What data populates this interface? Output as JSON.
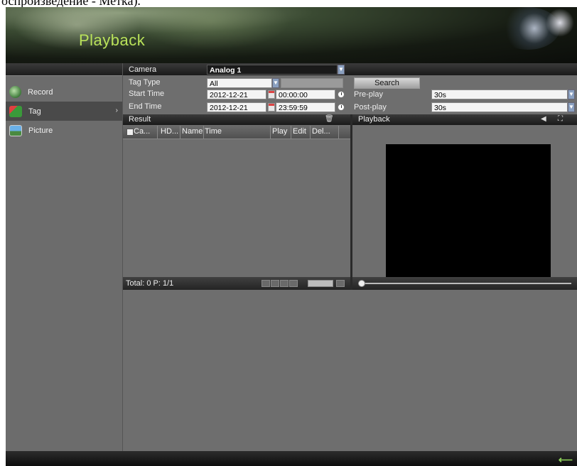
{
  "caption": {
    "text": "оспроизведение - Метка)."
  },
  "header": {
    "title": "Playback"
  },
  "sidebar": {
    "items": [
      {
        "label": "Record",
        "icon": "record-icon"
      },
      {
        "label": "Tag",
        "icon": "tag-icon",
        "arrow": "›",
        "active": true
      },
      {
        "label": "Picture",
        "icon": "picture-icon"
      }
    ]
  },
  "form": {
    "camera_label": "Camera",
    "camera_value": "Analog 1",
    "tag_type_label": "Tag Type",
    "tag_type_value": "All",
    "tag_type_text": "",
    "start_time_label": "Start Time",
    "start_date": "2012-12-21",
    "start_time": "00:00:00",
    "end_time_label": "End Time",
    "end_date": "2012-12-21",
    "end_time": "23:59:59",
    "search_label": "Search",
    "preplay_label": "Pre-play",
    "preplay_value": "30s",
    "postplay_label": "Post-play",
    "postplay_value": "30s"
  },
  "result": {
    "title": "Result",
    "columns": [
      "Ca...",
      "HD...",
      "Name",
      "Time",
      "Play",
      "Edit",
      "Del..."
    ],
    "rows": [],
    "total_text": "Total: 0  P: 1/1"
  },
  "playback": {
    "title": "Playback",
    "progress": 0
  },
  "icons": {
    "dropdown": "chevron-down-icon",
    "calendar": "calendar-icon",
    "clock": "clock-icon",
    "trash": "trash-icon",
    "volume": "volume-icon",
    "fullscreen": "fullscreen-icon",
    "back": "back-arrow-icon"
  },
  "colors": {
    "title": "#b9e25a",
    "panel": "#6e6e6e",
    "bar": "#1e1e1e",
    "video": "#000000"
  }
}
